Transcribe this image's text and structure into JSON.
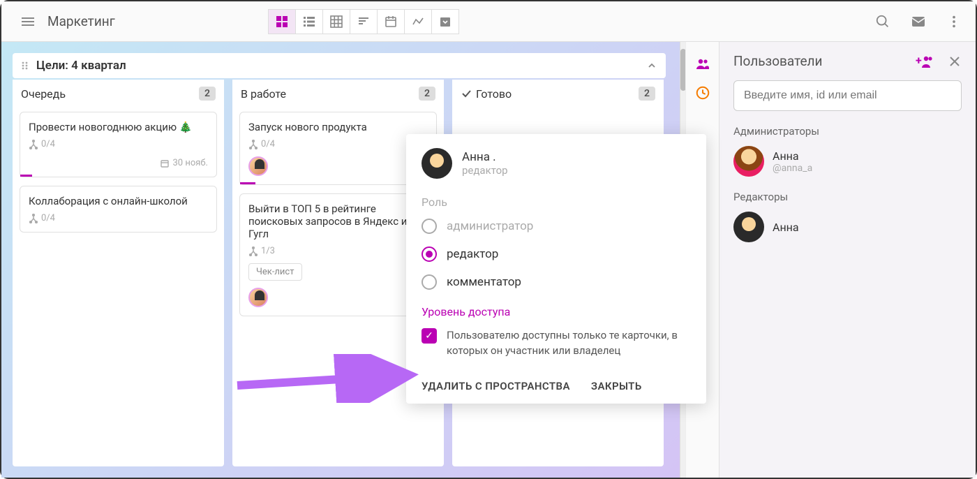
{
  "colors": {
    "accent": "#ba00b3",
    "arrow": "#b768f5"
  },
  "header": {
    "title": "Маркетинг"
  },
  "board": {
    "section_title": "Цели: 4 квартал",
    "columns": [
      {
        "title": "Очередь",
        "count": "2",
        "done": false,
        "cards": [
          {
            "title": "Провести новогоднюю акцию 🎄",
            "subtasks": "0/4",
            "date": "30 нояб.",
            "progress": 6
          },
          {
            "title": "Коллаборация с онлайн-школой",
            "subtasks": "0/4"
          }
        ]
      },
      {
        "title": "В работе",
        "count": "2",
        "done": false,
        "cards": [
          {
            "title": "Запуск нового продукта",
            "subtasks": "0/4",
            "avatar": true,
            "progress": 8
          },
          {
            "title": "Выйти в ТОП 5 в рейтинге поисковых запросов в Яндекс и Гугл",
            "subtasks": "1/3",
            "checklist": "Чек-лист",
            "avatar": true
          }
        ]
      },
      {
        "title": "Готово",
        "count": "2",
        "done": true,
        "cards": []
      }
    ]
  },
  "sidebar": {
    "title": "Пользователи",
    "search_placeholder": "Введите имя, id или email",
    "sections": {
      "admins_label": "Администраторы",
      "editors_label": "Редакторы"
    },
    "admins": [
      {
        "name": "Анна",
        "handle": "@anna_a",
        "avatar": "cartoon"
      }
    ],
    "editors": [
      {
        "name": "Анна",
        "avatar": "photo"
      }
    ]
  },
  "popup": {
    "user": {
      "name": "Анна .",
      "role": "редактор"
    },
    "role_label": "Роль",
    "roles": [
      {
        "key": "admin",
        "label": "администратор",
        "selected": false,
        "muted": true
      },
      {
        "key": "editor",
        "label": "редактор",
        "selected": true
      },
      {
        "key": "commenter",
        "label": "комментатор",
        "selected": false
      }
    ],
    "access_label": "Уровень доступа",
    "access_text": "Пользователю доступны только те карточки, в которых он участник или владелец",
    "access_checked": true,
    "actions": {
      "remove": "УДАЛИТЬ С ПРОСТРАНСТВА",
      "close": "ЗАКРЫТЬ"
    }
  }
}
